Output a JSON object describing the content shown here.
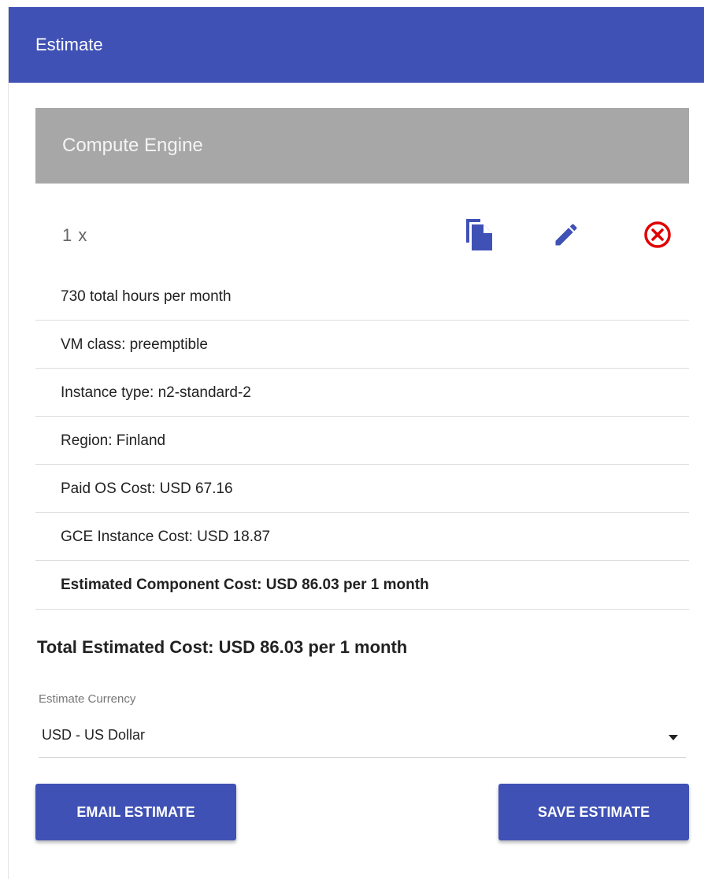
{
  "header": {
    "title": "Estimate"
  },
  "section": {
    "title": "Compute Engine"
  },
  "item": {
    "quantity_label": "1 x",
    "details": [
      "730 total hours per month",
      "VM class: preemptible",
      "Instance type: n2-standard-2",
      "Region: Finland",
      "Paid OS Cost: USD 67.16",
      "GCE Instance Cost: USD 18.87"
    ],
    "component_cost": "Estimated Component Cost: USD 86.03 per 1 month",
    "icons": [
      "copy-icon",
      "edit-icon",
      "remove-circle-icon"
    ]
  },
  "total": {
    "text": "Total Estimated Cost: USD 86.03 per 1 month"
  },
  "currency": {
    "label": "Estimate Currency",
    "selected": "USD - US Dollar"
  },
  "actions": {
    "email_label": "EMAIL ESTIMATE",
    "save_label": "SAVE ESTIMATE"
  },
  "colors": {
    "primary": "#3f51b5",
    "section_bg": "#a7a7a7",
    "remove_icon": "#e00000"
  }
}
